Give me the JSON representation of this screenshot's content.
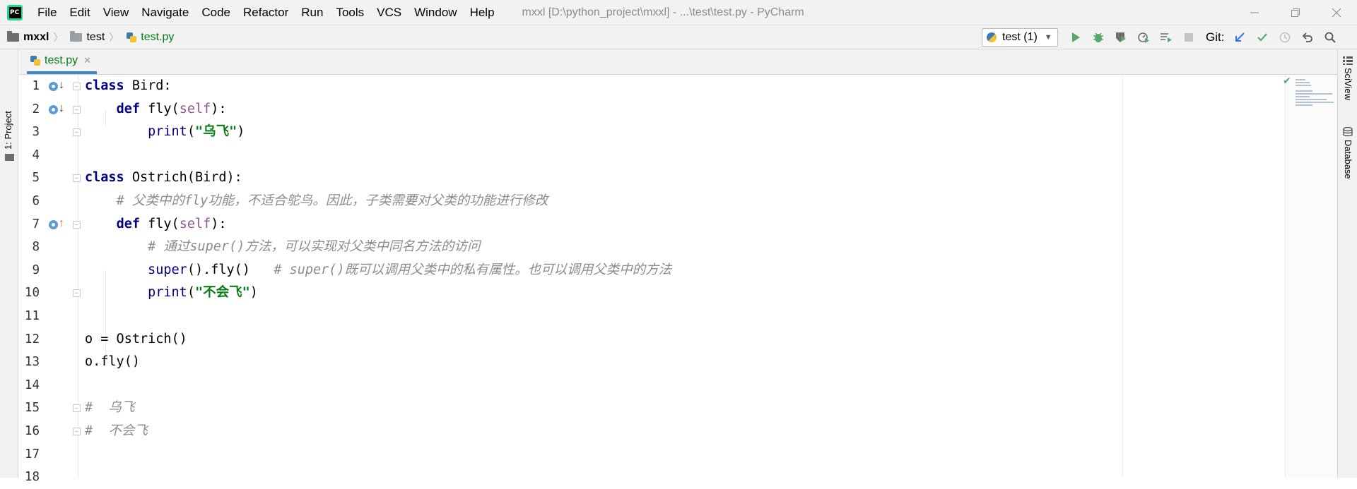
{
  "app": {
    "menu": [
      "File",
      "Edit",
      "View",
      "Navigate",
      "Code",
      "Refactor",
      "Run",
      "Tools",
      "VCS",
      "Window",
      "Help"
    ],
    "window_title": "mxxl [D:\\python_project\\mxxl] - ...\\test\\test.py - PyCharm"
  },
  "breadcrumb": {
    "project": "mxxl",
    "folder": "test",
    "file": "test.py"
  },
  "toolbar": {
    "run_config": "test (1)",
    "git_label": "Git:"
  },
  "side_panels": {
    "left": "1: Project",
    "right_top": "SciView",
    "right_bottom": "Database"
  },
  "editor": {
    "tab_label": "test.py",
    "line_numbers": [
      "1",
      "2",
      "3",
      "4",
      "5",
      "6",
      "7",
      "8",
      "9",
      "10",
      "11",
      "12",
      "13",
      "14",
      "15",
      "16",
      "17",
      "18"
    ],
    "lines": {
      "l1": {
        "kw": "class",
        "rest": " Bird:"
      },
      "l2": {
        "kw": "def",
        "name": " fly(",
        "self": "self",
        "end": "):"
      },
      "l3": {
        "fn": "print",
        "open": "(",
        "str": "\"乌飞\"",
        "close": ")"
      },
      "l5": {
        "kw": "class",
        "rest": " Ostrich(Bird):"
      },
      "l6": {
        "comment": "# 父类中的fly功能，不适合鸵鸟。因此，子类需要对父类的功能进行修改"
      },
      "l7": {
        "kw": "def",
        "name": " fly(",
        "self": "self",
        "end": "):"
      },
      "l8": {
        "comment": "# 通过super()方法，可以实现对父类中同名方法的访问"
      },
      "l9": {
        "code": "super",
        "rest": "().fly()   ",
        "comment": "# super()既可以调用父类中的私有属性。也可以调用父类中的方法"
      },
      "l10": {
        "fn": "print",
        "open": "(",
        "str": "\"不会飞\"",
        "close": ")"
      },
      "l12": {
        "code": "o = Ostrich()"
      },
      "l13": {
        "code": "o.fly()"
      },
      "l15": {
        "comment": "#  乌飞"
      },
      "l16": {
        "comment": "#  不会飞"
      }
    }
  }
}
